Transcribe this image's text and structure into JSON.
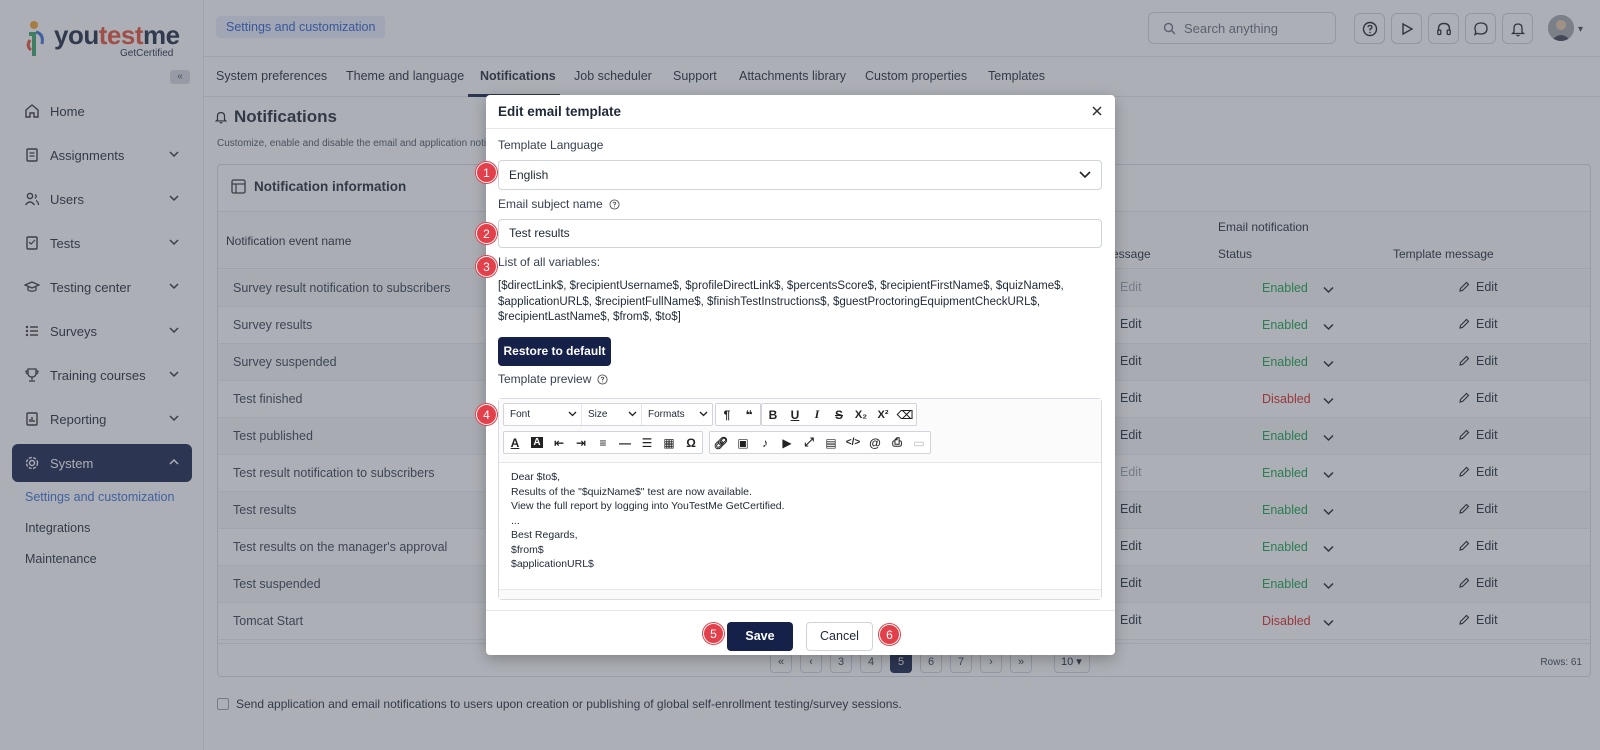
{
  "brand": {
    "name_prefix": "you",
    "name_accent": "test",
    "name_suffix": "me",
    "sub": "GetCertified"
  },
  "sidebar": {
    "items": [
      {
        "label": "Home",
        "icon": "home-icon"
      },
      {
        "label": "Assignments",
        "icon": "document-icon"
      },
      {
        "label": "Users",
        "icon": "users-icon"
      },
      {
        "label": "Tests",
        "icon": "test-icon"
      },
      {
        "label": "Testing center",
        "icon": "graduation-cap-icon"
      },
      {
        "label": "Surveys",
        "icon": "list-icon"
      },
      {
        "label": "Training courses",
        "icon": "trophy-icon"
      },
      {
        "label": "Reporting",
        "icon": "report-icon"
      },
      {
        "label": "System",
        "icon": "gear-icon"
      }
    ],
    "subitems": [
      "Settings and customization",
      "Integrations",
      "Maintenance"
    ]
  },
  "topbar": {
    "breadcrumb": "Settings and customization",
    "search_placeholder": "Search anything"
  },
  "tabs": [
    "System preferences",
    "Theme and language",
    "Notifications",
    "Job scheduler",
    "Support",
    "Attachments library",
    "Custom properties",
    "Templates"
  ],
  "page": {
    "title": "Notifications",
    "description": "Customize, enable and disable the email and application noti",
    "card_title": "Notification information",
    "col_event": "Notification event name",
    "col_app_template": "message",
    "col_email_group": "Email notification",
    "col_status": "Status",
    "col_email_template": "Template message",
    "edit_label": "Edit",
    "rows": [
      {
        "name": "Survey result notification to subscribers",
        "status": "Enabled",
        "app_edit_enabled": false
      },
      {
        "name": "Survey results",
        "status": "Enabled",
        "app_edit_enabled": true
      },
      {
        "name": "Survey suspended",
        "status": "Enabled",
        "app_edit_enabled": true
      },
      {
        "name": "Test finished",
        "status": "Disabled",
        "app_edit_enabled": true
      },
      {
        "name": "Test published",
        "status": "Enabled",
        "app_edit_enabled": true
      },
      {
        "name": "Test result notification to subscribers",
        "status": "Enabled",
        "app_edit_enabled": false
      },
      {
        "name": "Test results",
        "status": "Enabled",
        "app_edit_enabled": true
      },
      {
        "name": "Test results on the manager's approval",
        "status": "Enabled",
        "app_edit_enabled": true
      },
      {
        "name": "Test suspended",
        "status": "Enabled",
        "app_edit_enabled": true
      },
      {
        "name": "Tomcat Start",
        "status": "Disabled",
        "app_edit_enabled": true
      }
    ],
    "pages": [
      "3",
      "4",
      "5",
      "6",
      "7"
    ],
    "current_page": "5",
    "page_size": "10",
    "rows_count": "Rows: 61",
    "footer_checkbox": "Send application and email notifications to users upon creation or publishing of global self-enrollment testing/survey sessions."
  },
  "modal": {
    "title": "Edit email template",
    "language_label": "Template Language",
    "language_value": "English",
    "subject_label": "Email subject name",
    "subject_value": "Test results",
    "vars_label": "List of all variables:",
    "vars_text": "[$directLink$, $recipientUsername$, $profileDirectLink$, $percentsScore$, $recipientFirstName$, $quizName$, $applicationURL$, $recipientFullName$, $finishTestInstructions$, $guestProctoringEquipmentCheckURL$, $recipientLastName$, $from$, $to$]",
    "restore_label": "Restore to default",
    "preview_label": "Template preview",
    "toolbar": {
      "font": "Font",
      "size": "Size",
      "formats": "Formats"
    },
    "body_lines": [
      "Dear $to$,",
      "Results of the \"$quizName$\" test are now available.",
      "View the full report by logging into YouTestMe GetCertified.",
      "...",
      "Best Regards,",
      "$from$",
      "$applicationURL$"
    ],
    "save_label": "Save",
    "cancel_label": "Cancel"
  },
  "callouts": [
    "1",
    "2",
    "3",
    "4",
    "5",
    "6"
  ],
  "colors": {
    "accent": "#16214a",
    "enabled": "#16a34a",
    "disabled": "#dc2626",
    "callout": "#e2404a",
    "link": "#2f5fd0"
  }
}
